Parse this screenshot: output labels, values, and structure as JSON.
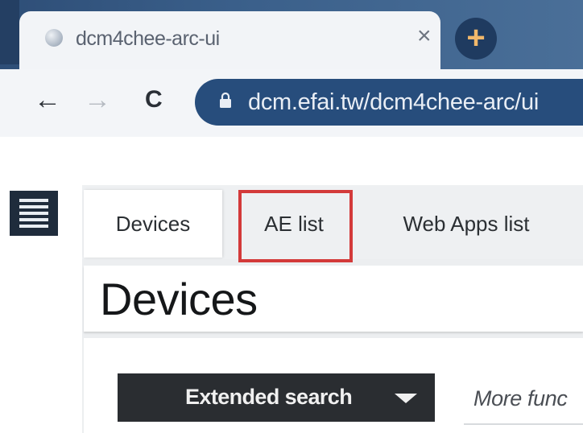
{
  "browser": {
    "tab_title": "dcm4chee-arc-ui",
    "tab_close": "×",
    "new_tab": "+",
    "back": "←",
    "forward": "→",
    "reload": "C",
    "url": "dcm.efai.tw/dcm4chee-arc/ui"
  },
  "nav_tabs": [
    {
      "label": "Devices",
      "active": true
    },
    {
      "label": "AE list",
      "active": false,
      "highlighted": true
    },
    {
      "label": "Web Apps list",
      "active": false
    }
  ],
  "page": {
    "title": "Devices",
    "extended_search_label": "Extended search",
    "more_functions_label": "More func"
  },
  "colors": {
    "browser_frame": "#2e4e77",
    "omnibox": "#274d7c",
    "highlight": "#d33a3a",
    "search_button": "#2a2d31"
  },
  "icons": {
    "menu": "hamburger-menu-icon",
    "lock": "lock-icon",
    "caret": "caret-down-icon",
    "favicon": "globe-icon"
  }
}
